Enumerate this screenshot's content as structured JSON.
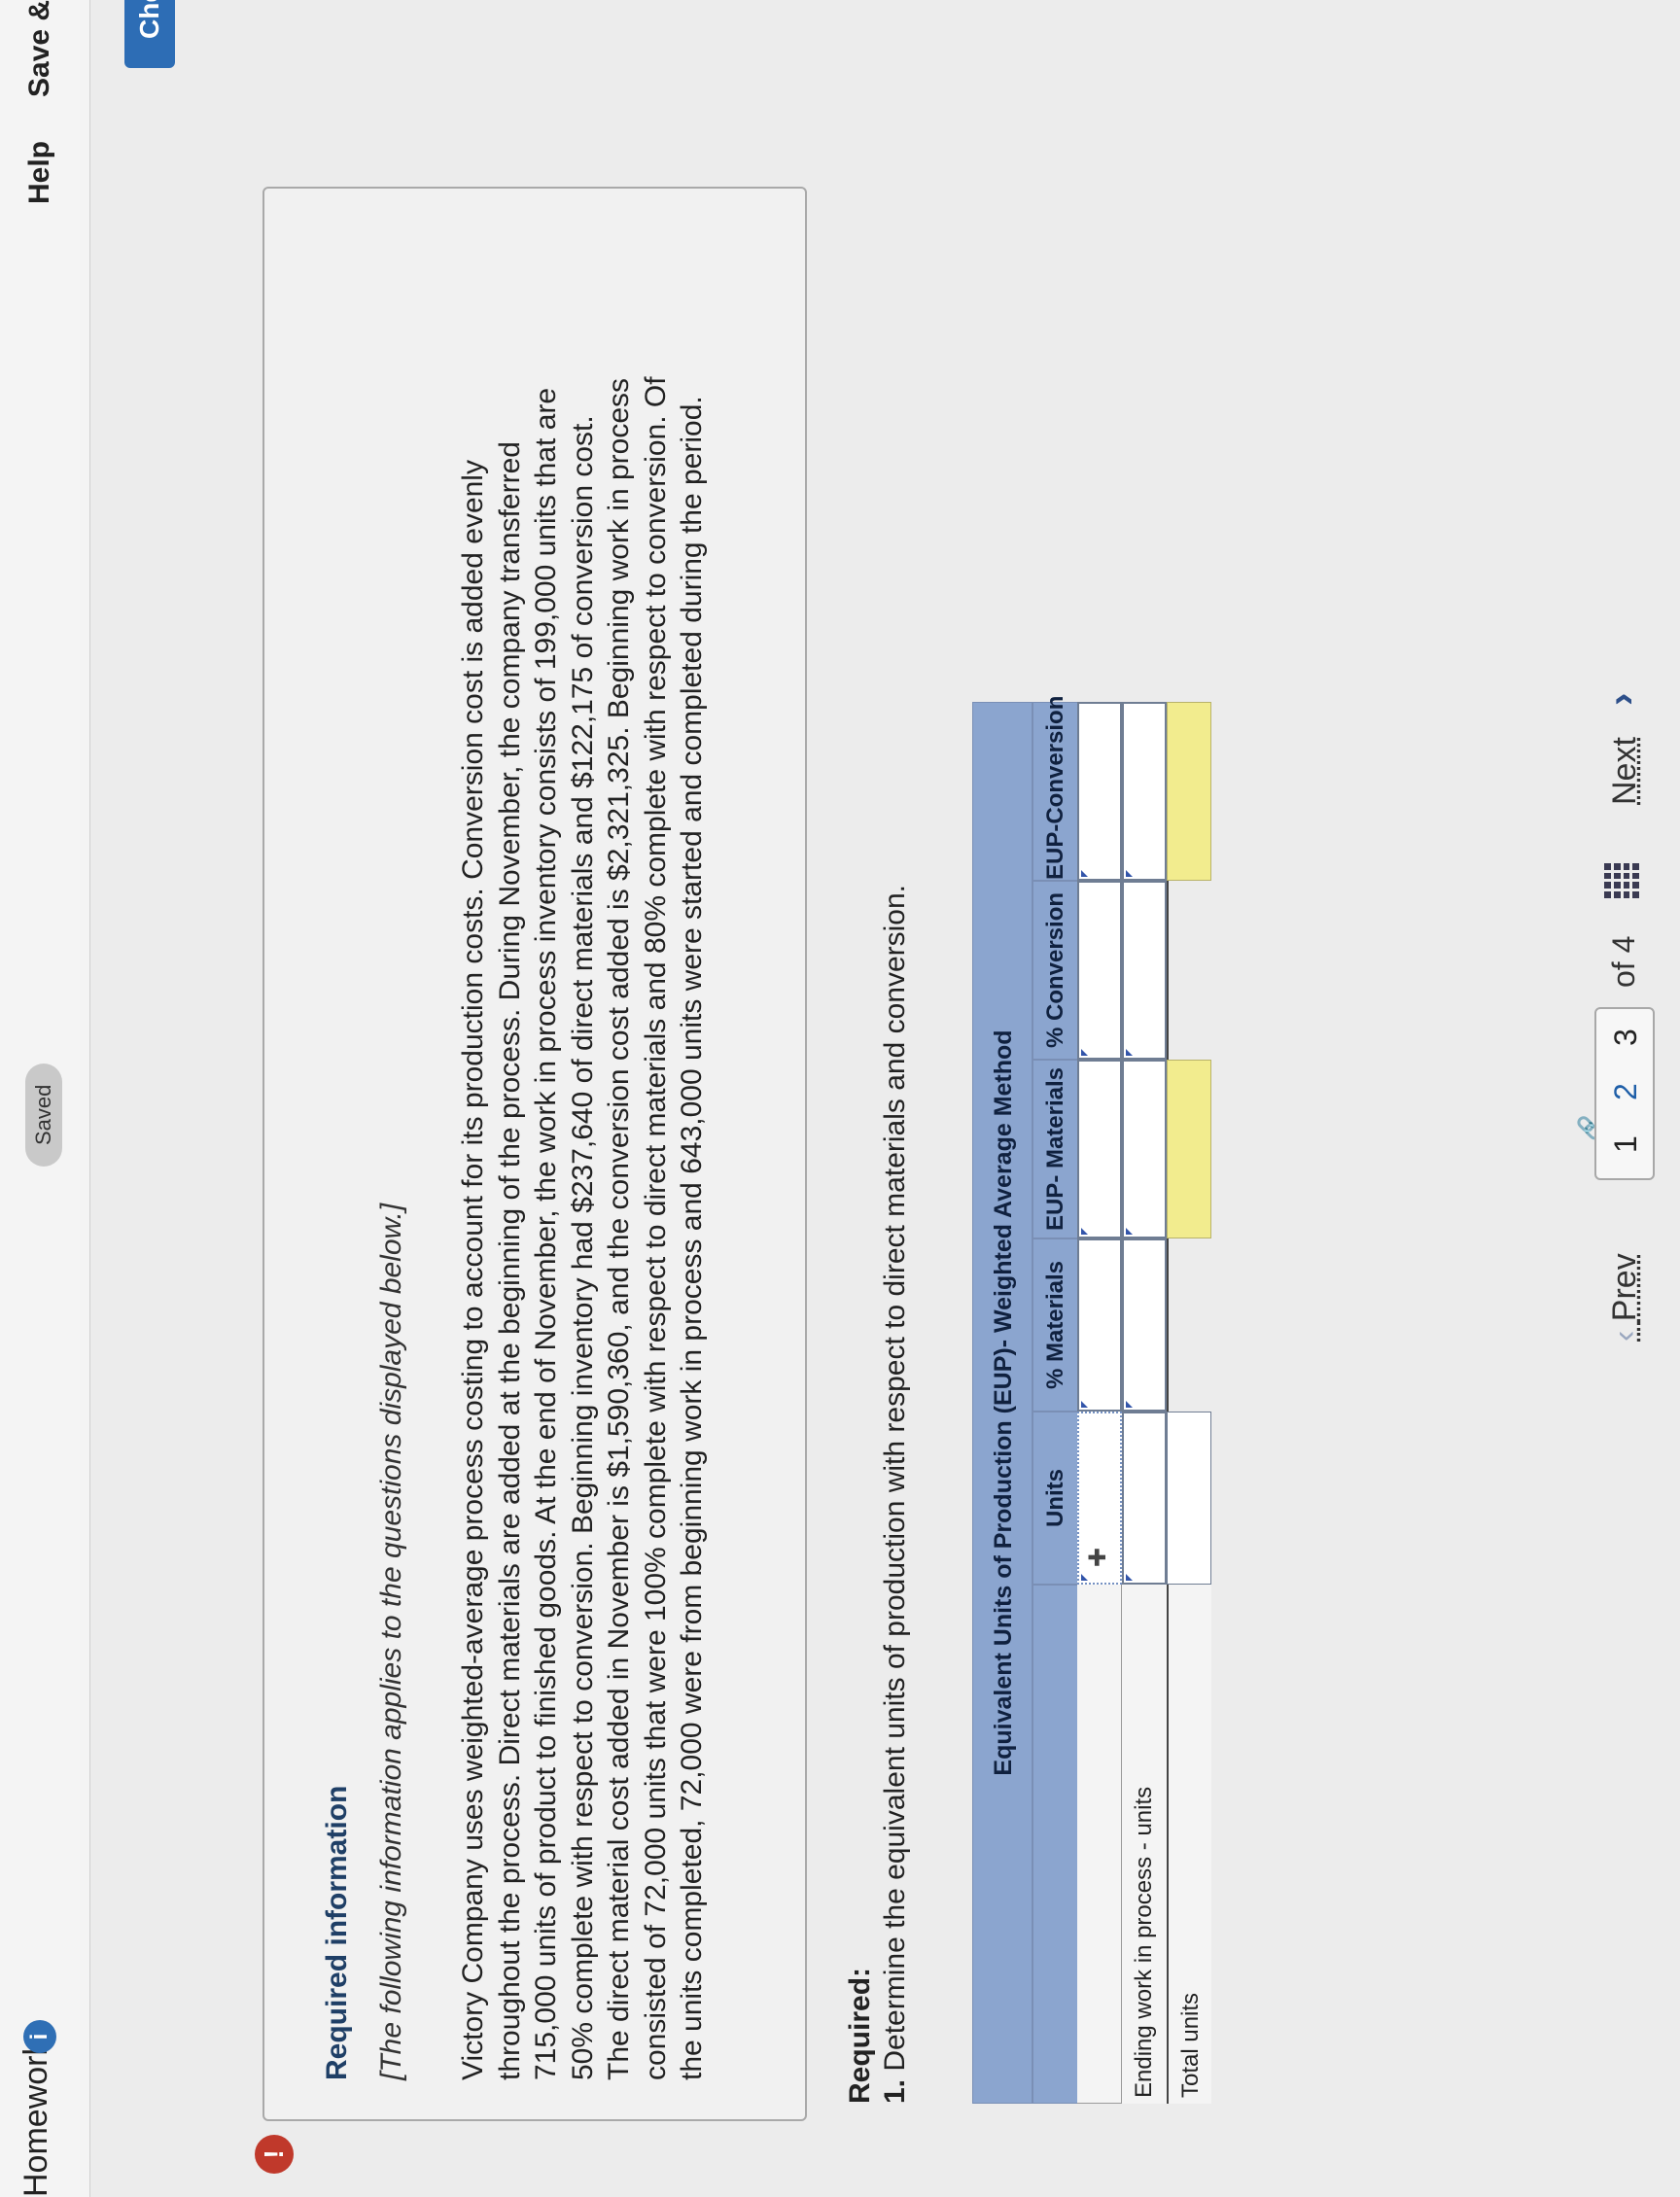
{
  "header": {
    "title": "Homework",
    "info_badge": "i",
    "saved": "Saved",
    "help": "Help",
    "save_exit": "Save & Exit",
    "check": "Check"
  },
  "alert_icon": "!",
  "info": {
    "heading": "Required information",
    "note": "[The following information applies to the questions displayed below.]",
    "paragraph": "Victory Company uses weighted-average process costing to account for its production costs. Conversion cost is added evenly throughout the process. Direct materials are added at the beginning of the process. During November, the company transferred 715,000 units of product to finished goods. At the end of November, the work in process inventory consists of 199,000 units that are 50% complete with respect to conversion. Beginning inventory had $237,640 of direct materials and $122,175 of conversion cost. The direct material cost added in November is $1,590,360, and the conversion cost added is $2,321,325. Beginning work in process consisted of 72,000 units that were 100% complete with respect to direct materials and 80% complete with respect to conversion. Of the units completed, 72,000 were from beginning work in process and 643,000 units were started and completed during the period."
  },
  "required": {
    "heading": "Required:",
    "question_number": "1.",
    "question": "Determine the equivalent units of production with respect to direct materials and conversion."
  },
  "table": {
    "title": "Equivalent Units of Production (EUP)- Weighted Average Method",
    "columns": [
      "Units",
      "% Materials",
      "EUP- Materials",
      "% Conversion",
      "EUP-Conversion"
    ],
    "rows": [
      {
        "label": "",
        "values": [
          "",
          "",
          "",
          "",
          ""
        ]
      },
      {
        "label": "Ending work in process - units",
        "values": [
          "",
          "",
          "",
          "",
          ""
        ]
      },
      {
        "label": "Total units",
        "values": [
          "",
          "",
          "",
          "",
          ""
        ]
      }
    ]
  },
  "pager": {
    "prev": "Prev",
    "pages": [
      "1",
      "2",
      "3"
    ],
    "of": "of 4",
    "next": "Next"
  },
  "icons": {
    "info": "info-circle-icon",
    "alert": "exclamation-icon",
    "link": "link-icon",
    "grid": "grid-icon",
    "prev": "chevron-left-icon",
    "next": "chevron-right-icon",
    "cursor": "plus-cursor-icon"
  },
  "colors": {
    "table_header": "#8ba5cf",
    "total_highlight": "#f2ec8e",
    "check_button": "#2d6db5",
    "alert": "#c0392b"
  }
}
